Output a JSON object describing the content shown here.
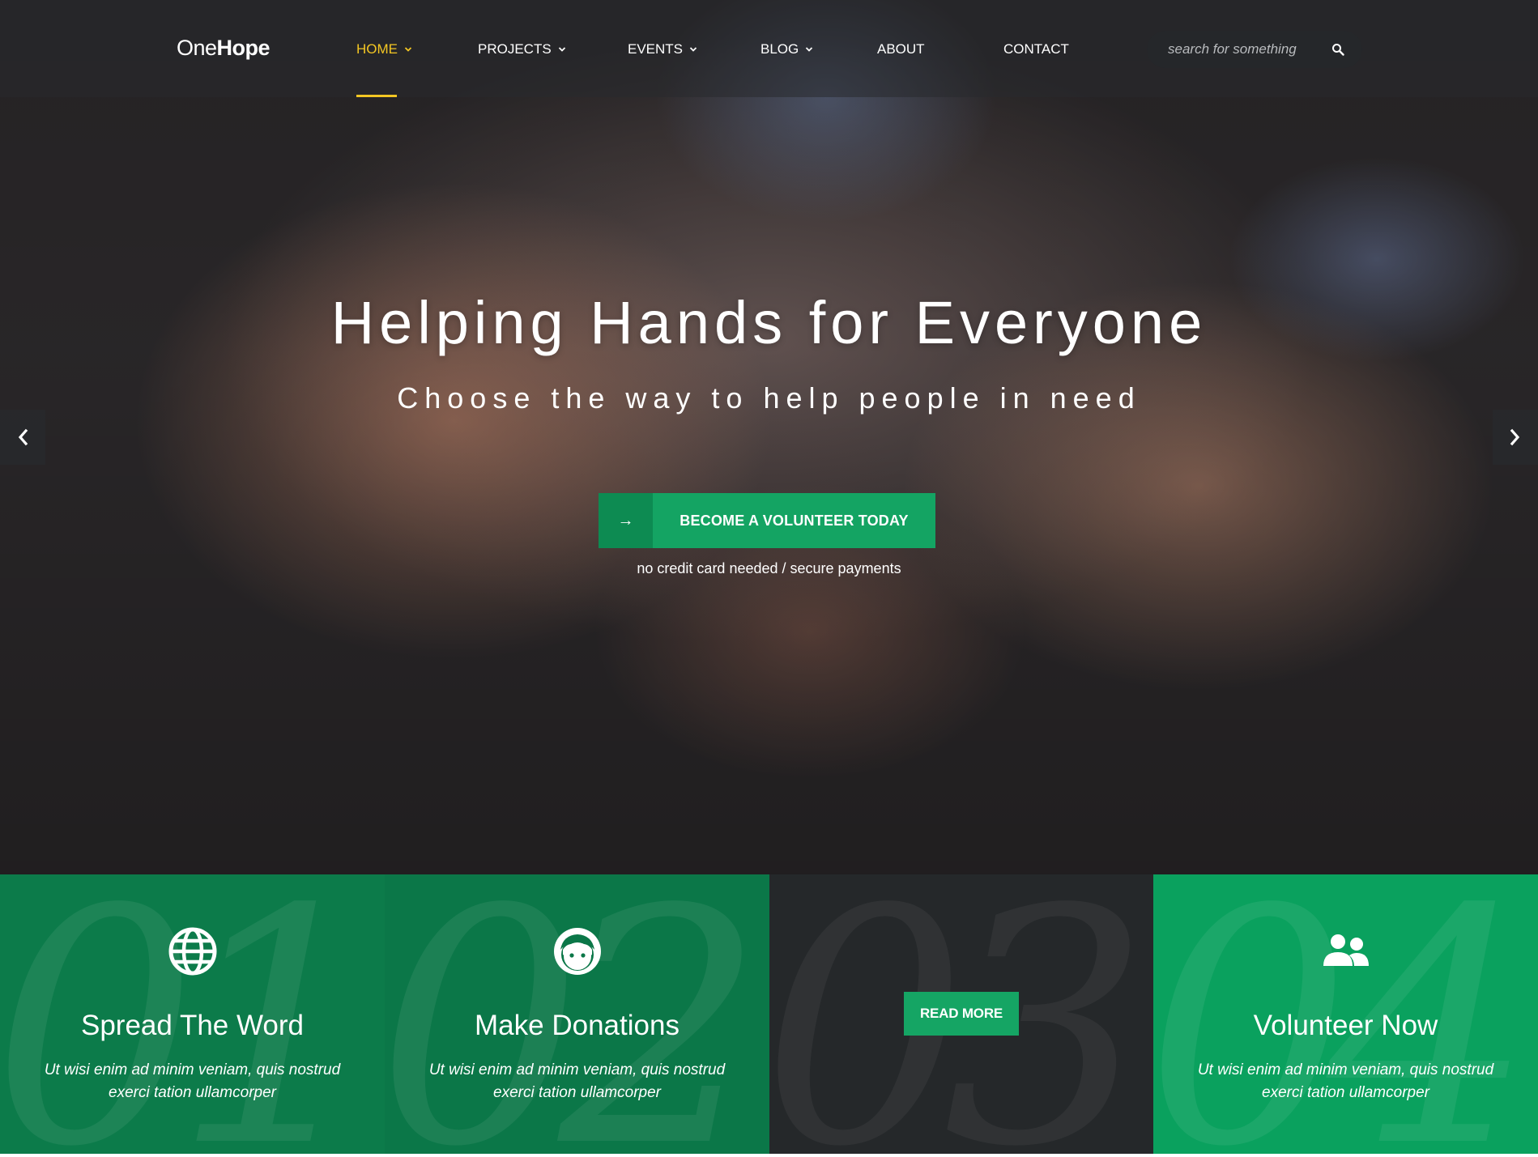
{
  "brand": {
    "logo_light": "One",
    "logo_bold": "Hope"
  },
  "nav": {
    "items": [
      {
        "label": "HOME",
        "has_dropdown": true,
        "active": true
      },
      {
        "label": "PROJECTS",
        "has_dropdown": true
      },
      {
        "label": "EVENTS",
        "has_dropdown": true
      },
      {
        "label": "BLOG",
        "has_dropdown": true
      },
      {
        "label": "ABOUT",
        "has_dropdown": false
      },
      {
        "label": "CONTACT",
        "has_dropdown": false
      }
    ],
    "chevron": "⌄",
    "active_color": "#f3c623"
  },
  "search": {
    "placeholder": "search for something",
    "icon": "search-icon"
  },
  "hero": {
    "title": "Helping Hands for Everyone",
    "subtitle": "Choose the way to help people in need",
    "cta_label": "BECOME A VOLUNTEER TODAY",
    "cta_arrow": "→",
    "cta_note": "no credit card needed / secure payments",
    "prev_icon": "chevron-left-icon",
    "next_icon": "chevron-right-icon"
  },
  "features": [
    {
      "number": "01",
      "icon": "globe-icon",
      "title": "Spread The Word",
      "desc": "Ut wisi enim ad minim veniam, quis nostrud exerci tation ullamcorper"
    },
    {
      "number": "02",
      "icon": "face-icon",
      "title": "Make Donations",
      "desc": "Ut wisi enim ad minim veniam, quis nostrud exerci tation ullamcorper"
    },
    {
      "number": "03",
      "button_label": "READ MORE"
    },
    {
      "number": "04",
      "icon": "people-icon",
      "title": "Volunteer Now",
      "desc": "Ut wisi enim ad minim veniam, quis nostrud exerci tation ullamcorper"
    }
  ],
  "colors": {
    "green": "#14a463",
    "dark_green": "#0c7b4a",
    "bright_green": "#0aa15e",
    "dark": "#25282a",
    "accent": "#f3c623"
  }
}
